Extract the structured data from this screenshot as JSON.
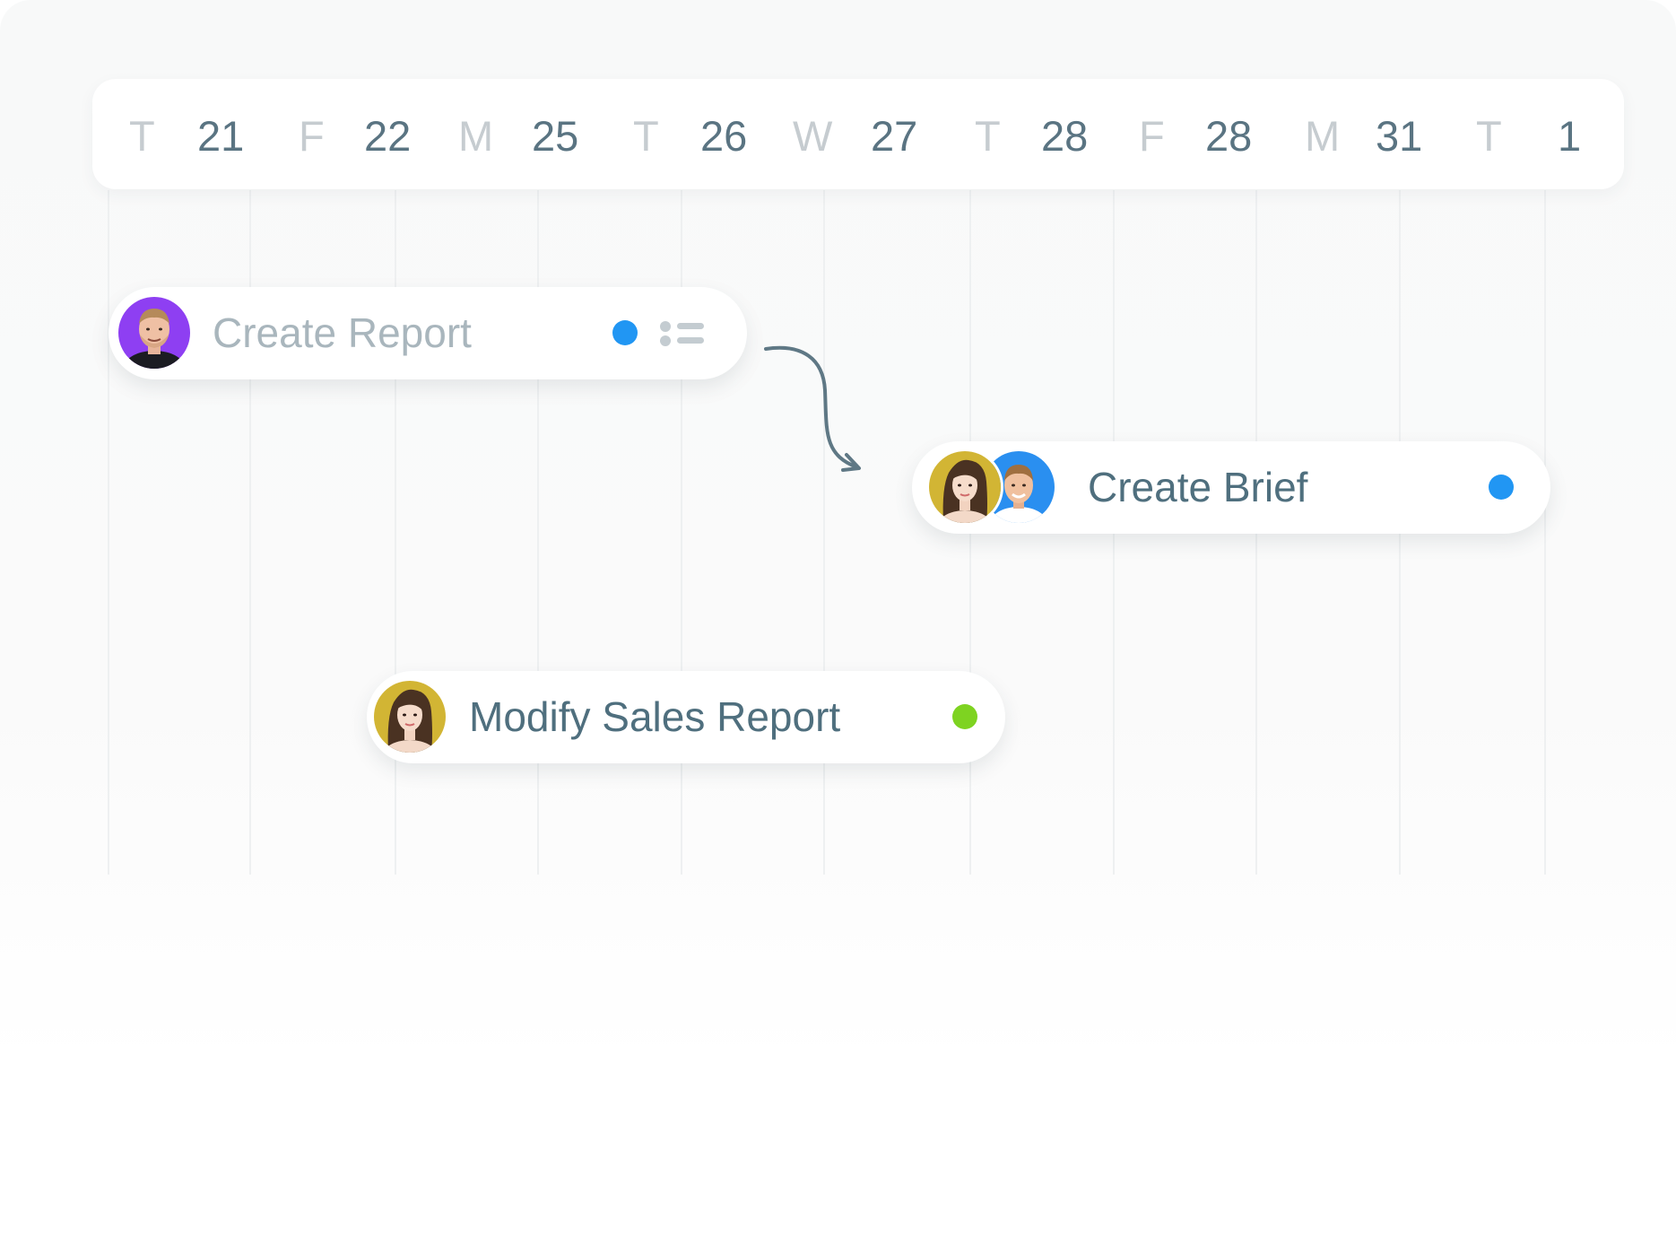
{
  "timeline": {
    "days": [
      {
        "weekday": "T",
        "date": "21"
      },
      {
        "weekday": "F",
        "date": "22"
      },
      {
        "weekday": "M",
        "date": "25"
      },
      {
        "weekday": "T",
        "date": "26"
      },
      {
        "weekday": "W",
        "date": "27"
      },
      {
        "weekday": "T",
        "date": "28"
      },
      {
        "weekday": "F",
        "date": "28"
      },
      {
        "weekday": "M",
        "date": "31"
      },
      {
        "weekday": "T",
        "date": "1"
      }
    ]
  },
  "tasks": [
    {
      "label": "Create Report",
      "status_color": "#2196f3",
      "dimmed": true,
      "icon": "list-icon"
    },
    {
      "label": "Create Brief",
      "status_color": "#2196f3"
    },
    {
      "label": "Modify Sales Report",
      "status_color": "#7ed321"
    }
  ],
  "dependency": {
    "icon": "curved-arrow-icon"
  },
  "colors": {
    "weekday": "#c6ccd0",
    "date": "#5a7482",
    "task_text": "#4f6f7e",
    "task_text_dimmed": "#a9b6bd"
  }
}
